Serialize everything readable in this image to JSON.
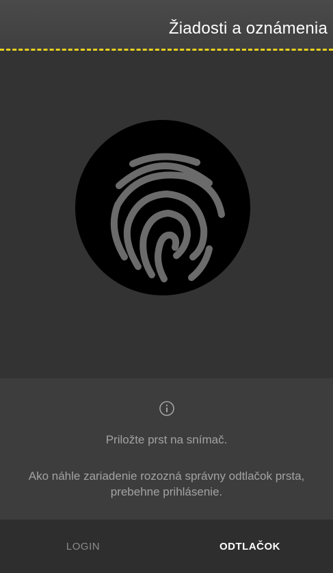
{
  "header": {
    "title": "Žiadosti a oznámenia"
  },
  "scanner": {
    "icon": "fingerprint-icon"
  },
  "info": {
    "icon": "info-icon",
    "prompt": "Priložte prst na snímač.",
    "description": "Ako náhle zariadenie rozozná správny odtlačok prsta, prebehne prihlásenie."
  },
  "tabs": {
    "login": "LOGIN",
    "fingerprint": "ODTLAČOK",
    "active": "fingerprint"
  },
  "colors": {
    "accent": "#e8d21c",
    "background": "#333333",
    "text_muted": "#a3a3a3"
  }
}
